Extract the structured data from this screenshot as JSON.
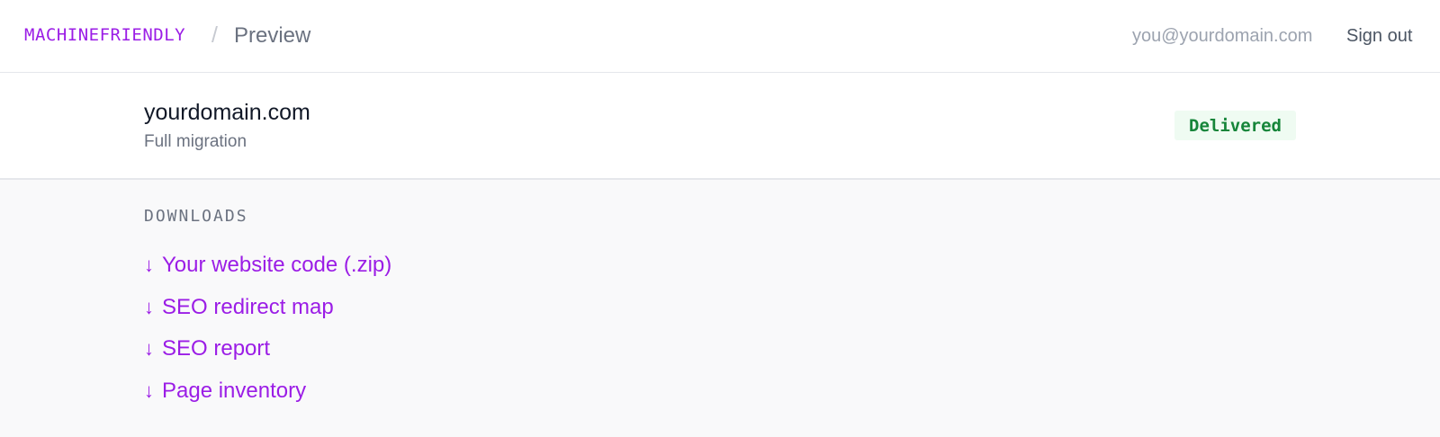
{
  "header": {
    "brand": "MACHINEFRIENDLY",
    "separator": "/",
    "breadcrumb": "Preview",
    "user_email": "you@yourdomain.com",
    "sign_out_label": "Sign out"
  },
  "project": {
    "domain": "yourdomain.com",
    "type": "Full migration",
    "status": "Delivered"
  },
  "downloads": {
    "section_label": "DOWNLOADS",
    "icon": "download-arrow-icon",
    "items": [
      {
        "label": "Your website code (.zip)"
      },
      {
        "label": "SEO redirect map"
      },
      {
        "label": "SEO report"
      },
      {
        "label": "Page inventory"
      }
    ]
  },
  "colors": {
    "accent": "#9b1de6",
    "status_text": "#16853a",
    "status_bg": "#effbf2",
    "page_bg": "#f9f9fa"
  }
}
